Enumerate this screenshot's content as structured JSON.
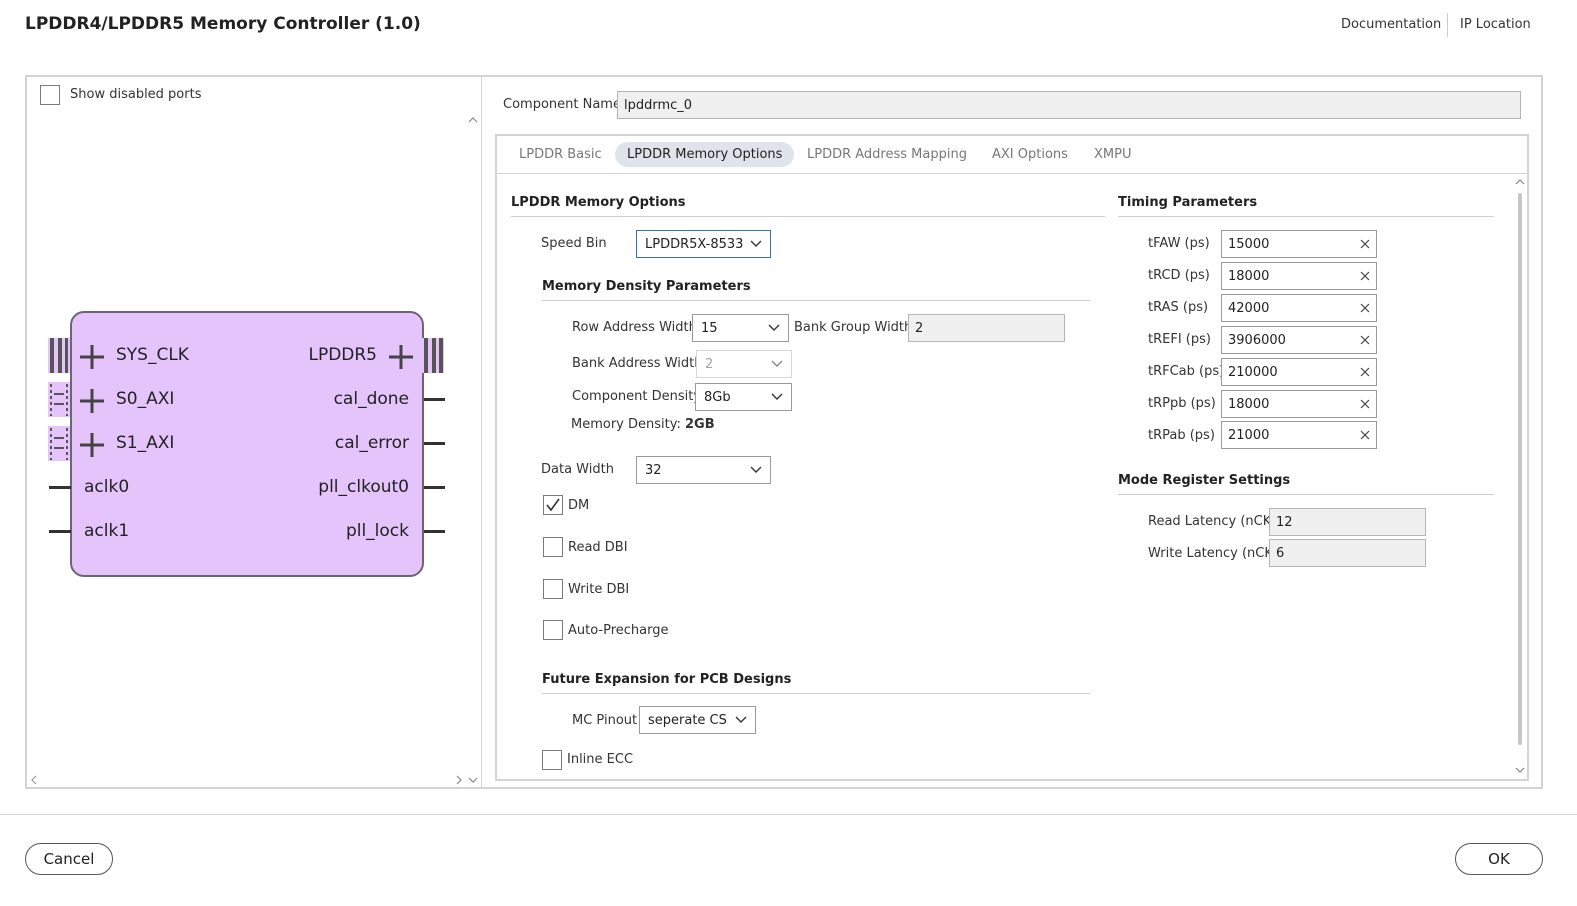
{
  "header": {
    "title": "LPDDR4/LPDDR5  Memory Controller (1.0)",
    "documentation": "Documentation",
    "ip_location": "IP Location"
  },
  "left_panel": {
    "show_disabled_ports": "Show disabled ports",
    "block": {
      "left_ports": [
        "SYS_CLK",
        "S0_AXI",
        "S1_AXI",
        "aclk0",
        "aclk1"
      ],
      "right_ports": [
        "LPDDR5",
        "cal_done",
        "cal_error",
        "pll_clkout0",
        "pll_lock"
      ],
      "fill_color": "#e4c4fb",
      "border_color": "#6d6478"
    }
  },
  "component": {
    "label": "Component Name",
    "value": "lpddrmc_0"
  },
  "tabs": [
    {
      "label": "LPDDR Basic"
    },
    {
      "label": "LPDDR Memory Options"
    },
    {
      "label": "LPDDR Address Mapping"
    },
    {
      "label": "AXI Options"
    },
    {
      "label": "XMPU"
    }
  ],
  "active_tab": "LPDDR Memory Options",
  "memory_options": {
    "section_title": "LPDDR Memory Options",
    "speed_bin": {
      "label": "Speed Bin",
      "value": "LPDDR5X-8533"
    },
    "density": {
      "title": "Memory Density Parameters",
      "row_address_width": {
        "label": "Row Address Width",
        "value": "15"
      },
      "bank_group_width": {
        "label": "Bank Group Width",
        "value": "2"
      },
      "bank_address_width": {
        "label": "Bank Address Width",
        "value": "2"
      },
      "component_density": {
        "label": "Component Density",
        "value": "8Gb"
      },
      "memory_density_label": "Memory Density:",
      "memory_density_value": "2GB"
    },
    "data_width": {
      "label": "Data Width",
      "value": "32"
    },
    "dm": {
      "label": "DM",
      "checked": true
    },
    "read_dbi": {
      "label": "Read DBI",
      "checked": false
    },
    "write_dbi": {
      "label": "Write DBI",
      "checked": false
    },
    "auto_precharge": {
      "label": "Auto-Precharge",
      "checked": false
    },
    "future": {
      "title": "Future Expansion for PCB Designs",
      "mc_pinout": {
        "label": "MC Pinout",
        "value": "seperate CS"
      },
      "inline_ecc": {
        "label": "Inline ECC",
        "checked": false
      }
    }
  },
  "timing": {
    "title": "Timing Parameters",
    "params": [
      {
        "label": "tFAW (ps)",
        "value": "15000"
      },
      {
        "label": "tRCD (ps)",
        "value": "18000"
      },
      {
        "label": "tRAS (ps)",
        "value": "42000"
      },
      {
        "label": "tREFI (ps)",
        "value": "3906000"
      },
      {
        "label": "tRFCab (ps)",
        "value": "210000"
      },
      {
        "label": "tRPpb (ps)",
        "value": "18000"
      },
      {
        "label": "tRPab (ps)",
        "value": "21000"
      }
    ]
  },
  "mode_register": {
    "title": "Mode Register Settings",
    "read_latency": {
      "label": "Read Latency (nCK)",
      "value": "12"
    },
    "write_latency": {
      "label": "Write Latency (nCK)",
      "value": "6"
    }
  },
  "footer": {
    "cancel": "Cancel",
    "ok": "OK"
  }
}
